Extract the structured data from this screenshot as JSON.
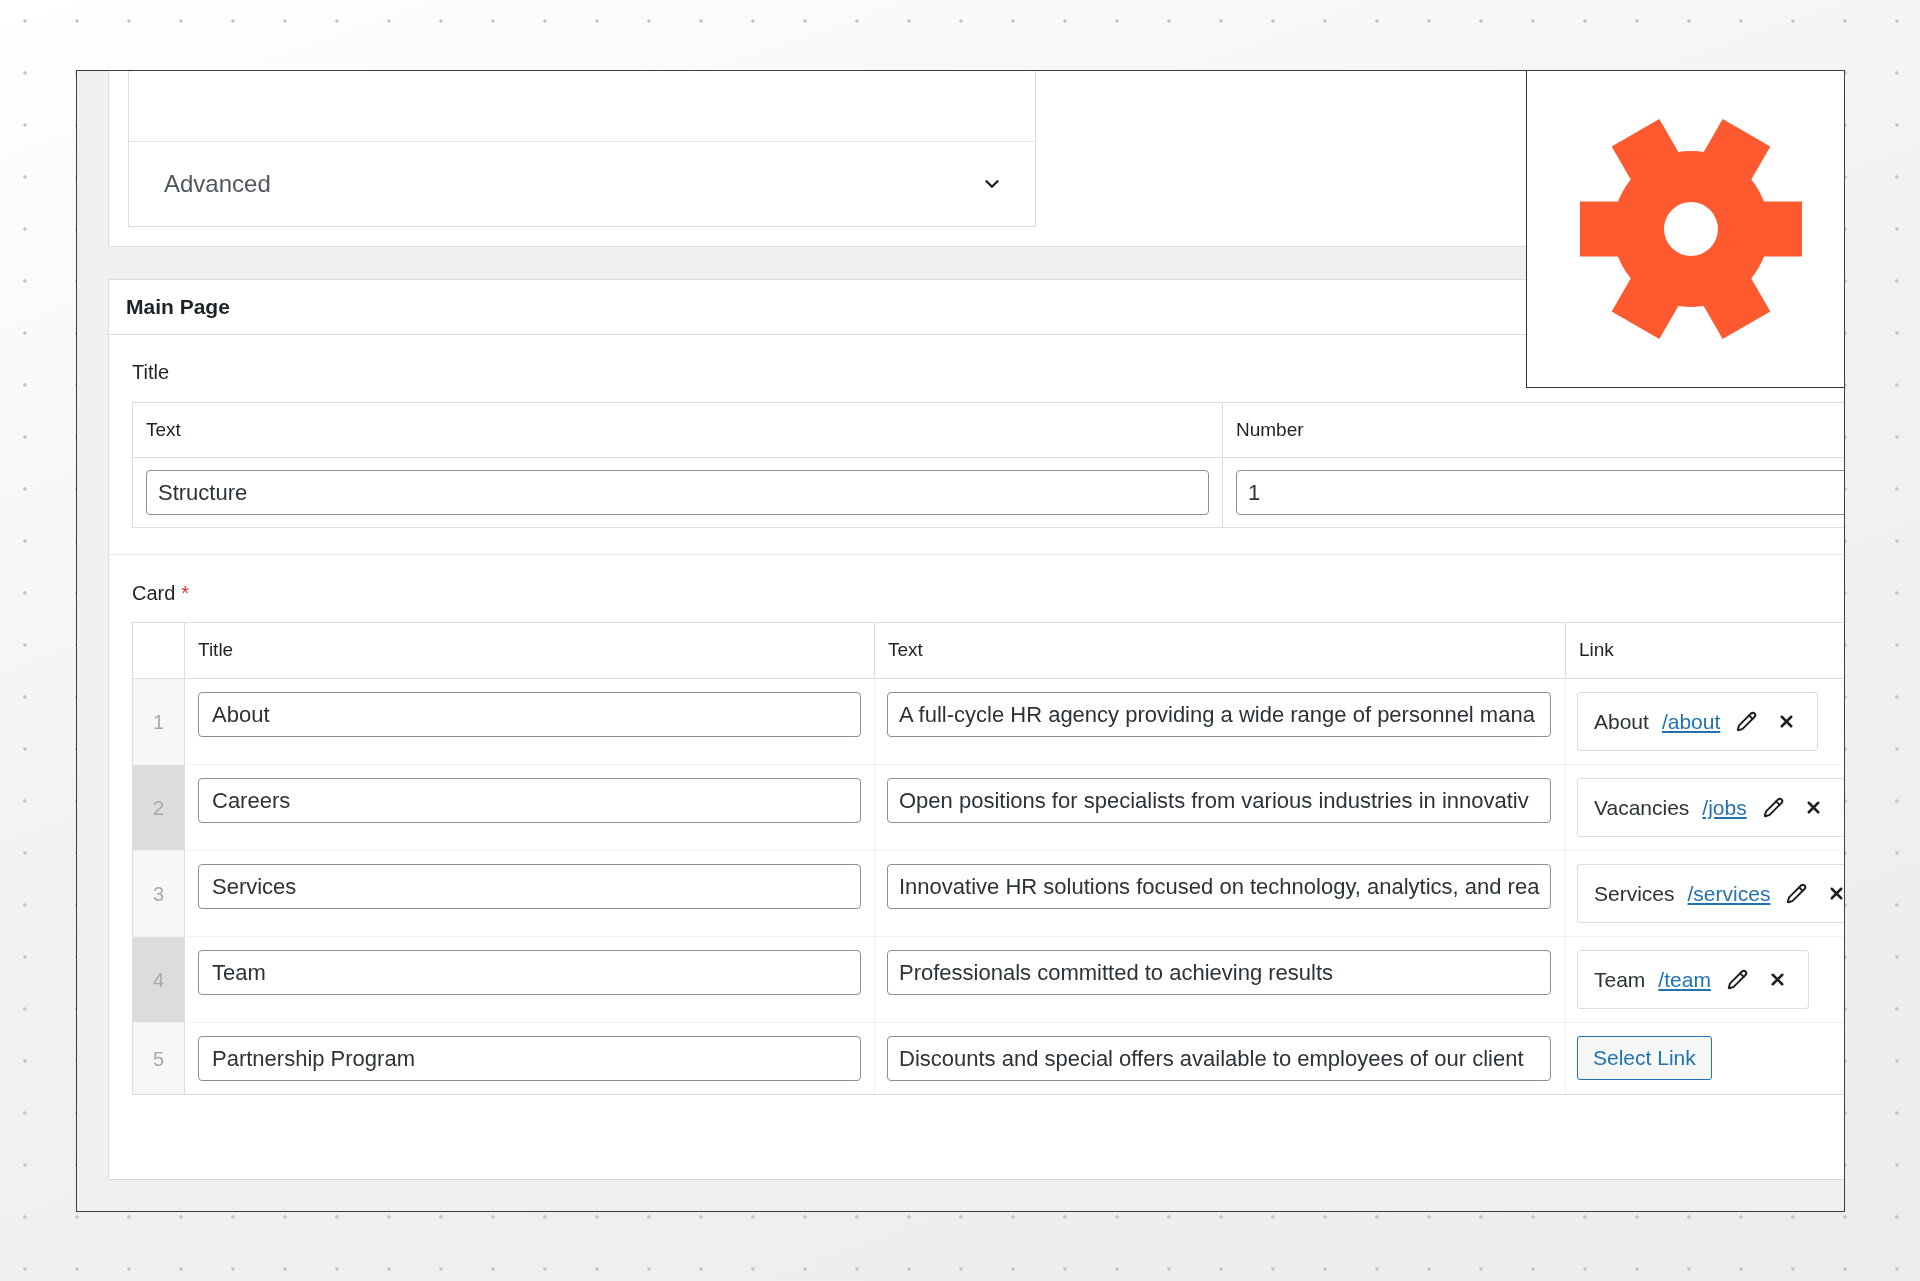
{
  "settings_panel": {
    "accordion": {
      "label": "Advanced",
      "expanded": false
    }
  },
  "main_panel": {
    "title": "Main Page",
    "title_group": {
      "label": "Title",
      "columns": [
        "Text",
        "Number"
      ],
      "values": [
        "Structure",
        "1"
      ]
    },
    "card": {
      "label": "Card",
      "required_mark": "*",
      "columns": [
        "Title",
        "Text",
        "Link"
      ],
      "rows": [
        {
          "index": "1",
          "highlighted": false,
          "title": "About",
          "text": "A full-cycle HR agency providing a wide range of personnel mana",
          "link": {
            "kind": "link",
            "label": "About",
            "url": "/about"
          }
        },
        {
          "index": "2",
          "highlighted": true,
          "title": "Careers",
          "text": "Open positions for specialists from various industries in innovativ",
          "link": {
            "kind": "link",
            "label": "Vacancies",
            "url": "/jobs"
          }
        },
        {
          "index": "3",
          "highlighted": false,
          "title": "Services",
          "text": "Innovative HR solutions focused on technology, analytics, and rea",
          "link": {
            "kind": "link",
            "label": "Services",
            "url": "/services"
          }
        },
        {
          "index": "4",
          "highlighted": true,
          "title": "Team",
          "text": "Professionals committed to achieving results",
          "link": {
            "kind": "link",
            "label": "Team",
            "url": "/team"
          }
        },
        {
          "index": "5",
          "highlighted": false,
          "title": "Partnership Program",
          "text": "Discounts and special offers available to employees of our client",
          "link": {
            "kind": "empty",
            "button": "Select Link"
          }
        }
      ]
    }
  }
}
